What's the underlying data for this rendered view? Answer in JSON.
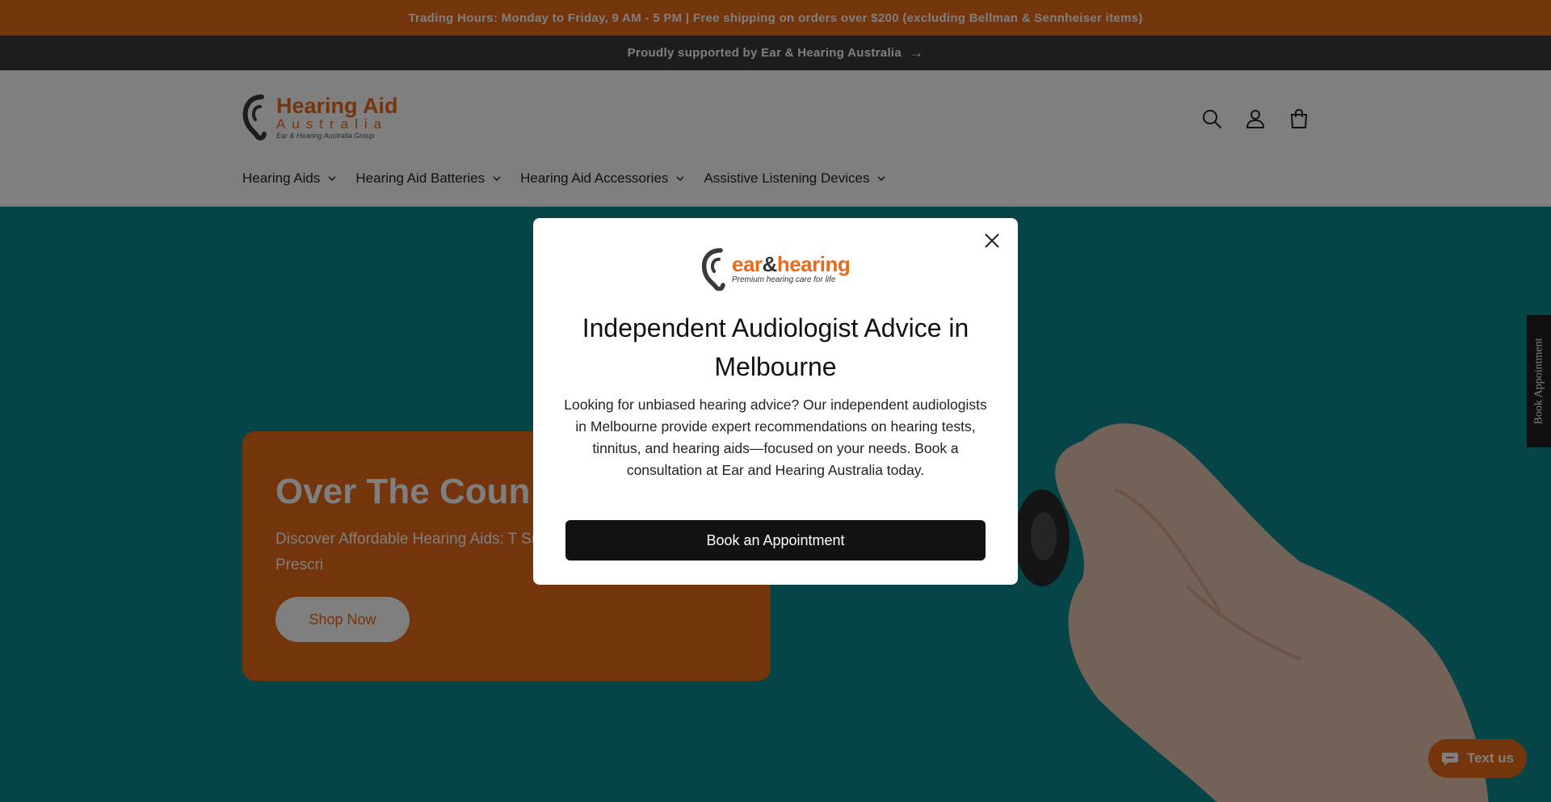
{
  "announcement": {
    "text": "Trading Hours: Monday to Friday, 9 AM - 5 PM | Free shipping on orders over $200 (excluding Bellman & Sennheiser items)"
  },
  "support_bar": {
    "text": "Proudly supported by Ear & Hearing Australia",
    "arrow": "→"
  },
  "header": {
    "logo": {
      "line1": "Hearing Aid",
      "line2": "Australia",
      "line3": "Ear & Hearing Australia Group"
    },
    "icons": [
      "search-icon",
      "account-icon",
      "cart-icon"
    ],
    "nav": [
      {
        "label": "Hearing Aids"
      },
      {
        "label": "Hearing Aid Batteries"
      },
      {
        "label": "Hearing Aid Accessories"
      },
      {
        "label": "Assistive Listening Devices"
      }
    ]
  },
  "hero": {
    "title": "Over The Coun",
    "text": "Discover Affordable Hearing Aids: T Surprisingly Low Prices! No Prescri",
    "button": "Shop Now"
  },
  "book_tab": {
    "label": "Book Appointment"
  },
  "chat_widget": {
    "label": "Text us"
  },
  "modal": {
    "logo": {
      "name_part1": "ear",
      "name_part2": "&",
      "name_part3": "hearing",
      "tagline": "Premium hearing care for life"
    },
    "title": "Independent Audiologist Advice in Melbourne",
    "body": "Looking for unbiased hearing advice? Our independent audiologists in Melbourne provide expert recommendations on hearing tests, tinnitus, and hearing aids—focused on your needs. Book a consultation at Ear and Hearing Australia today.",
    "cta": "Book an Appointment"
  },
  "colors": {
    "brand_orange": "#e86a1a",
    "teal": "#0d8a8e",
    "dark": "#121212"
  }
}
